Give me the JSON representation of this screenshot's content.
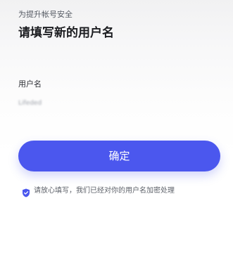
{
  "header": {
    "subtitle": "为提升帐号安全",
    "title": "请填写新的用户名"
  },
  "form": {
    "username_label": "用户名",
    "username_value": "Lifeded"
  },
  "actions": {
    "confirm_label": "确定"
  },
  "notice": {
    "icon": "shield-check-icon",
    "text": "请放心填写，我们已经对你的用户名加密处理"
  },
  "colors": {
    "accent": "#4b57ee",
    "shield": "#4b57ee",
    "title": "#1c1d21",
    "muted_text": "#5d6169"
  }
}
